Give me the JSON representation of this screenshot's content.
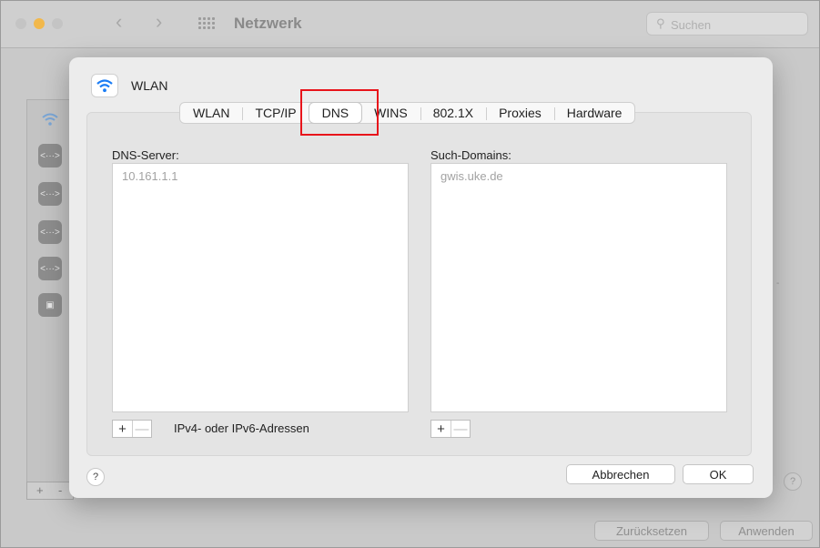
{
  "window": {
    "title": "Netzwerk",
    "search_placeholder": "Suchen",
    "reset_label": "Zurücksetzen",
    "apply_label": "Anwenden",
    "help_label": "?",
    "sidebar_add": "+",
    "sidebar_remove": "-"
  },
  "sheet": {
    "title": "WLAN",
    "tabs": [
      {
        "label": "WLAN"
      },
      {
        "label": "TCP/IP"
      },
      {
        "label": "DNS",
        "active": true
      },
      {
        "label": "WINS"
      },
      {
        "label": "802.1X"
      },
      {
        "label": "Proxies"
      },
      {
        "label": "Hardware"
      }
    ],
    "dns_servers": {
      "label": "DNS-Server:",
      "entries": [
        "10.161.1.1"
      ],
      "add": "+",
      "remove": "—",
      "hint": "IPv4- oder IPv6-Adressen"
    },
    "search_domains": {
      "label": "Such-Domains:",
      "entries": [
        "gwis.uke.de"
      ],
      "add": "+",
      "remove": "—"
    },
    "help_label": "?",
    "cancel_label": "Abbrechen",
    "ok_label": "OK"
  },
  "colors": {
    "highlight": "#e8141b",
    "minimize_light": "#f2b84b"
  }
}
